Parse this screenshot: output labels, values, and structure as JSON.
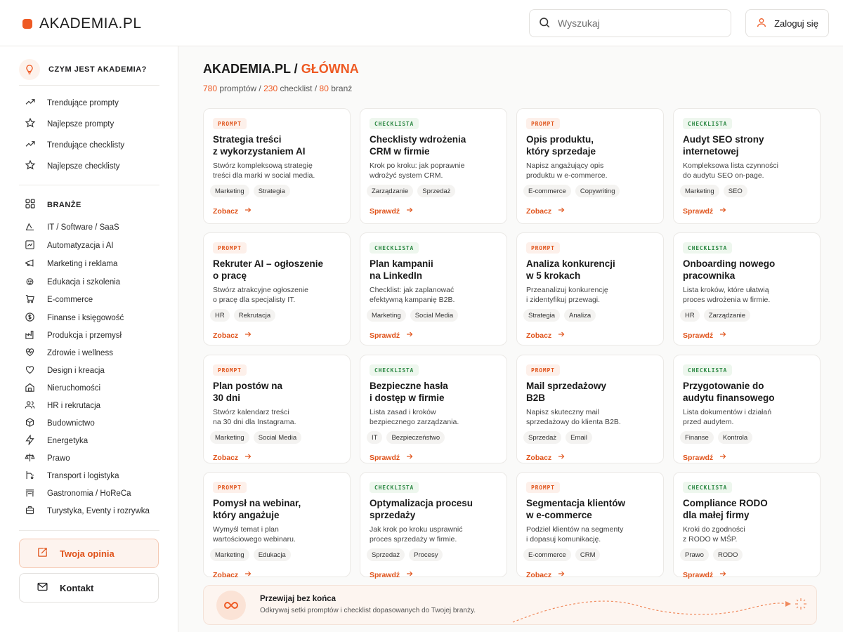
{
  "header": {
    "logo": "AKADEMIA.PL",
    "search_placeholder": "Wyszukaj",
    "login_label": "Zaloguj się"
  },
  "sidebar": {
    "about_label": "CZYM JEST AKADEMIA?",
    "nav": [
      {
        "label": "Trendujące prompty",
        "icon": "trending-icon"
      },
      {
        "label": "Najlepsze prompty",
        "icon": "star-icon"
      },
      {
        "label": "Trendujące checklisty",
        "icon": "trending-icon"
      },
      {
        "label": "Najlepsze checklisty",
        "icon": "star-icon"
      }
    ],
    "industries_title": "BRANŻE",
    "industries": [
      {
        "label": "IT / Software / SaaS",
        "icon": "code-icon"
      },
      {
        "label": "Automatyzacja i AI",
        "icon": "automation-icon"
      },
      {
        "label": "Marketing i reklama",
        "icon": "megaphone-icon"
      },
      {
        "label": "Edukacja i szkolenia",
        "icon": "education-icon"
      },
      {
        "label": "E-commerce",
        "icon": "cart-icon"
      },
      {
        "label": "Finanse i księgowość",
        "icon": "coin-icon"
      },
      {
        "label": "Produkcja i przemysł",
        "icon": "factory-icon"
      },
      {
        "label": "Zdrowie i wellness",
        "icon": "health-icon"
      },
      {
        "label": "Design i kreacja",
        "icon": "heart-icon"
      },
      {
        "label": "Nieruchomości",
        "icon": "house-icon"
      },
      {
        "label": "HR i rekrutacja",
        "icon": "people-icon"
      },
      {
        "label": "Budownictwo",
        "icon": "box-icon"
      },
      {
        "label": "Energetyka",
        "icon": "bolt-icon"
      },
      {
        "label": "Prawo",
        "icon": "scales-icon"
      },
      {
        "label": "Transport i logistyka",
        "icon": "truck-icon"
      },
      {
        "label": "Gastronomia / HoReCa",
        "icon": "restaurant-icon"
      },
      {
        "label": "Turystyka, Eventy i rozrywka",
        "icon": "suitcase-icon"
      }
    ],
    "opinion_label": "Twoja opinia",
    "contact_label": "Kontakt"
  },
  "main": {
    "title_prefix": "AKADEMIA.PL /",
    "title_accent": "GŁÓWNA",
    "stats": {
      "prompts_num": "780",
      "prompts_label": "promptów",
      "checklists_num": "230",
      "checklists_label": "checklist",
      "industries_num": "80",
      "industries_label": "branż",
      "sep": "/"
    },
    "cards": [
      {
        "type": "prompt",
        "badge": "PROMPT",
        "title": "Strategia treści\nz wykorzystaniem AI",
        "desc": "Stwórz kompleksową strategię\ntreści dla marki w social media.",
        "tags": [
          "Marketing",
          "Strategia"
        ],
        "link": "Zobacz"
      },
      {
        "type": "check",
        "badge": "CHECKLISTA",
        "title": "Checklisty wdrożenia\nCRM w firmie",
        "desc": "Krok po kroku: jak poprawnie\nwdrożyć system CRM.",
        "tags": [
          "Zarządzanie",
          "Sprzedaż"
        ],
        "link": "Sprawdź"
      },
      {
        "type": "prompt",
        "badge": "PROMPT",
        "title": "Opis produktu,\nktóry sprzedaje",
        "desc": "Napisz angażujący opis\nproduktu w e-commerce.",
        "tags": [
          "E-commerce",
          "Copywriting"
        ],
        "link": "Zobacz"
      },
      {
        "type": "check",
        "badge": "CHECKLISTA",
        "title": "Audyt SEO strony\ninternetowej",
        "desc": "Kompleksowa lista czynności\ndo audytu SEO on-page.",
        "tags": [
          "Marketing",
          "SEO"
        ],
        "link": "Sprawdź"
      },
      {
        "type": "prompt",
        "badge": "PROMPT",
        "title": "Rekruter AI – ogłoszenie\no pracę",
        "desc": "Stwórz atrakcyjne ogłoszenie\no pracę dla specjalisty IT.",
        "tags": [
          "HR",
          "Rekrutacja"
        ],
        "link": "Zobacz"
      },
      {
        "type": "check",
        "badge": "CHECKLISTA",
        "title": "Plan kampanii\nna LinkedIn",
        "desc": "Checklist: jak zaplanować\nefektywną kampanię B2B.",
        "tags": [
          "Marketing",
          "Social Media"
        ],
        "link": "Sprawdź"
      },
      {
        "type": "prompt",
        "badge": "PROMPT",
        "title": "Analiza konkurencji\nw 5 krokach",
        "desc": "Przeanalizuj konkurencję\ni zidentyfikuj przewagi.",
        "tags": [
          "Strategia",
          "Analiza"
        ],
        "link": "Zobacz"
      },
      {
        "type": "check",
        "badge": "CHECKLISTA",
        "title": "Onboarding nowego\npracownika",
        "desc": "Lista kroków, które ułatwią\nproces wdrożenia w firmie.",
        "tags": [
          "HR",
          "Zarządzanie"
        ],
        "link": "Sprawdź"
      },
      {
        "type": "prompt",
        "badge": "PROMPT",
        "title": "Plan postów na\n30 dni",
        "desc": "Stwórz kalendarz treści\nna 30 dni dla Instagrama.",
        "tags": [
          "Marketing",
          "Social Media"
        ],
        "link": "Zobacz"
      },
      {
        "type": "check",
        "badge": "CHECKLISTA",
        "title": "Bezpieczne hasła\ni dostęp w firmie",
        "desc": "Lista zasad i kroków\nbezpiecznego zarządzania.",
        "tags": [
          "IT",
          "Bezpieczeństwo"
        ],
        "link": "Sprawdź"
      },
      {
        "type": "prompt",
        "badge": "PROMPT",
        "title": "Mail sprzedażowy\nB2B",
        "desc": "Napisz skuteczny mail\nsprzedażowy do klienta B2B.",
        "tags": [
          "Sprzedaż",
          "Email"
        ],
        "link": "Zobacz"
      },
      {
        "type": "check",
        "badge": "CHECKLISTA",
        "title": "Przygotowanie do\naudytu finansowego",
        "desc": "Lista dokumentów i działań\nprzed audytem.",
        "tags": [
          "Finanse",
          "Kontrola"
        ],
        "link": "Sprawdź"
      },
      {
        "type": "prompt",
        "badge": "PROMPT",
        "title": "Pomysł na webinar,\nktóry angażuje",
        "desc": "Wymyśl temat i plan\nwartościowego webinaru.",
        "tags": [
          "Marketing",
          "Edukacja"
        ],
        "link": "Zobacz"
      },
      {
        "type": "check",
        "badge": "CHECKLISTA",
        "title": "Optymalizacja procesu\nsprzedaży",
        "desc": "Jak krok po kroku usprawnić\nproces sprzedaży w firmie.",
        "tags": [
          "Sprzedaż",
          "Procesy"
        ],
        "link": "Sprawdź"
      },
      {
        "type": "prompt",
        "badge": "PROMPT",
        "title": "Segmentacja klientów\nw e-commerce",
        "desc": "Podziel klientów na segmenty\ni dopasuj komunikację.",
        "tags": [
          "E-commerce",
          "CRM"
        ],
        "link": "Zobacz"
      },
      {
        "type": "check",
        "badge": "CHECKLISTA",
        "title": "Compliance RODO\ndla małej firmy",
        "desc": "Kroki do zgodności\nz RODO w MŚP.",
        "tags": [
          "Prawo",
          "RODO"
        ],
        "link": "Sprawdź"
      }
    ],
    "banner": {
      "title": "Przewijaj bez końca",
      "subtitle": "Odkrywaj setki promptów i checklist dopasowanych do Twojej branży."
    }
  },
  "colors": {
    "accent": "#ee5a24",
    "checklist_green": "#2f8a46"
  }
}
